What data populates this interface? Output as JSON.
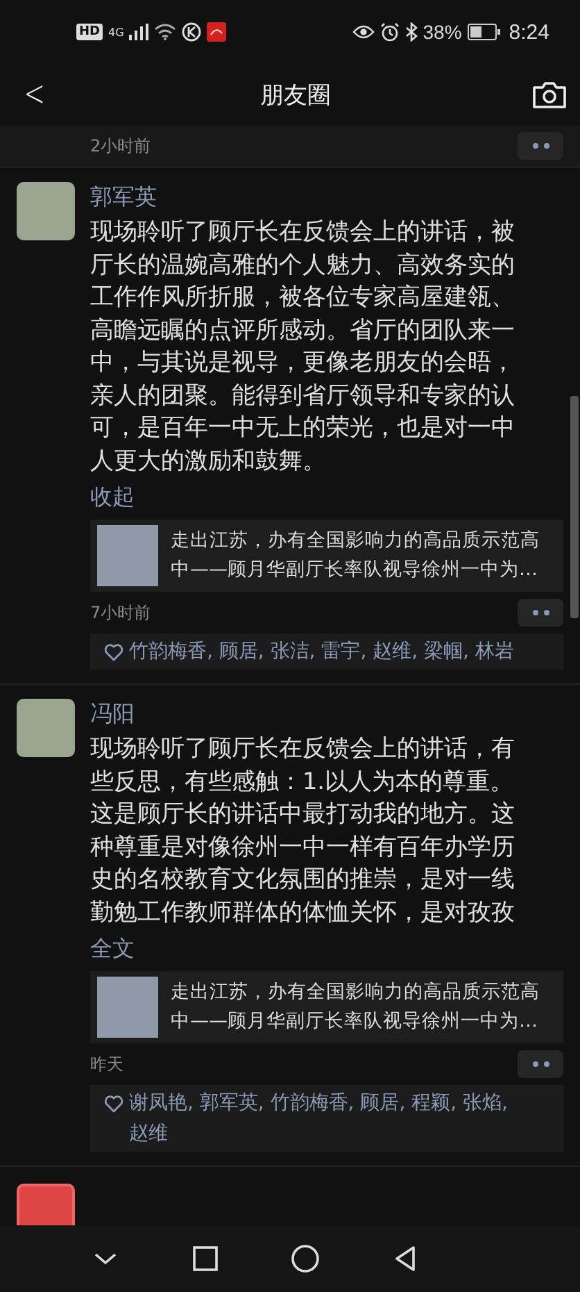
{
  "status_bar": {
    "hd": "HD",
    "network": "4G",
    "battery_percent": "38%",
    "time": "8:24"
  },
  "nav_bar": {
    "back": "<",
    "title": "朋友圈"
  },
  "top_item": {
    "time": "2小时前"
  },
  "posts": [
    {
      "author": "郭军英",
      "text": "现场聆听了顾厅长在反馈会上的讲话，被厅长的温婉高雅的个人魅力、高效务实的工作作风所折服，被各位专家高屋建瓴、高瞻远瞩的点评所感动。省厅的团队来一中，与其说是视导，更像老朋友的会晤，亲人的团聚。能得到省厅领导和专家的认可，是百年一中无上的荣光，也是对一中人更大的激励和鼓舞。",
      "toggle": "收起",
      "link": {
        "title": "走出江苏，办有全国影响力的高品质示范高中——顾月华副厅长率队视导徐州一中为…"
      },
      "time": "7小时前",
      "likes": "竹韵梅香, 顾居, 张洁, 雷宇, 赵维, 梁帼, 林岩"
    },
    {
      "author": "冯阳",
      "text": "现场聆听了顾厅长在反馈会上的讲话，有些反思，有些感触：1.以人为本的尊重。这是顾厅长的讲话中最打动我的地方。这种尊重是对像徐州一中一样有百年办学历史的名校教育文化氛围的推崇，是对一线勤勉工作教师群体的体恤关怀，是对孜孜",
      "toggle": "全文",
      "link": {
        "title": "走出江苏，办有全国影响力的高品质示范高中——顾月华副厅长率队视导徐州一中为…"
      },
      "time": "昨天",
      "likes": "谢凤艳, 郭军英, 竹韵梅香, 顾居, 程颖, 张焰, 赵维"
    }
  ]
}
